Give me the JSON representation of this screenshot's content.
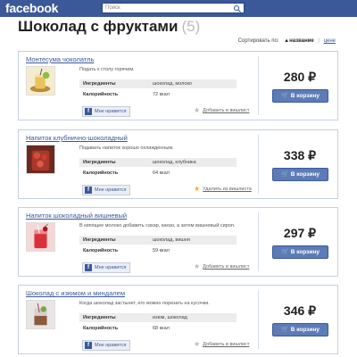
{
  "header": {
    "logo": "facebook",
    "search_placeholder": "Поиск"
  },
  "page": {
    "title": "Шоколад с фруктами",
    "count": "(5)"
  },
  "sort": {
    "label": "Сортировать по:",
    "active": "▲название",
    "separator": "|",
    "link": "цене"
  },
  "labels": {
    "ingredients": "Ингредиенты",
    "calories": "Калорийность",
    "like": "Мне нравится",
    "cart": "В корзину"
  },
  "products": [
    {
      "title": "Монтесума чоколатль",
      "desc": "Подать к столу горячим.",
      "ingredients": "шоколад, молоко",
      "calories": "72 ккал",
      "wish": "Добавить в вишлист",
      "wished": false,
      "price": "280 ₽"
    },
    {
      "title": "Напиток клубнично-шоколадный",
      "desc": "Подавать напиток хорошо охлажденным.",
      "ingredients": "шоколад, клубника",
      "calories": "64 ккал",
      "wish": "Удалить из вишлиста",
      "wished": true,
      "price": "338 ₽"
    },
    {
      "title": "Напиток шоколадный вишневый",
      "desc": "В кипящее молоко добавить сахар, какао, а затем вишневый сироп.",
      "ingredients": "шоколад, вишня",
      "calories": "59 ккал",
      "wish": "Добавить в вишлист",
      "wished": false,
      "price": "297 ₽"
    },
    {
      "title": "Шоколад с изюмом и миндалем",
      "desc": "Когда шоколад застынет, его можно порезать на кусочки.",
      "ingredients": "изюм, шоколад",
      "calories": "68 ккал",
      "wish": "Добавить в вишлист",
      "wished": false,
      "price": "346 ₽"
    }
  ],
  "colors": {
    "brand": "#3b5998",
    "button": "#5d7cb7",
    "star_active": "#f5a623"
  }
}
